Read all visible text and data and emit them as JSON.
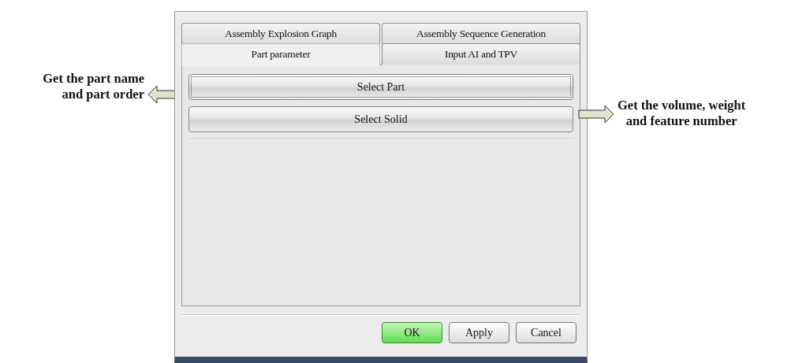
{
  "annotations": [
    {
      "kind": "left",
      "lines": [
        "Get the part name",
        "and part order"
      ]
    },
    {
      "kind": "right",
      "lines": [
        "Get the volume, weight",
        "and feature number"
      ]
    }
  ],
  "tab_rows": [
    [
      {
        "label": "Assembly Explosion Graph",
        "selected": false
      },
      {
        "label": "Assembly Sequence Generation",
        "selected": false
      }
    ],
    [
      {
        "label": "Part parameter",
        "selected": true
      },
      {
        "label": "Input AI and TPV",
        "selected": false
      }
    ]
  ],
  "panel_buttons": [
    {
      "label": "Select Part",
      "focused": true
    },
    {
      "label": "Select Solid",
      "focused": false
    }
  ],
  "dialog_buttons": [
    {
      "label": "OK",
      "default": true
    },
    {
      "label": "Apply",
      "default": false
    },
    {
      "label": "Cancel",
      "default": false
    }
  ]
}
